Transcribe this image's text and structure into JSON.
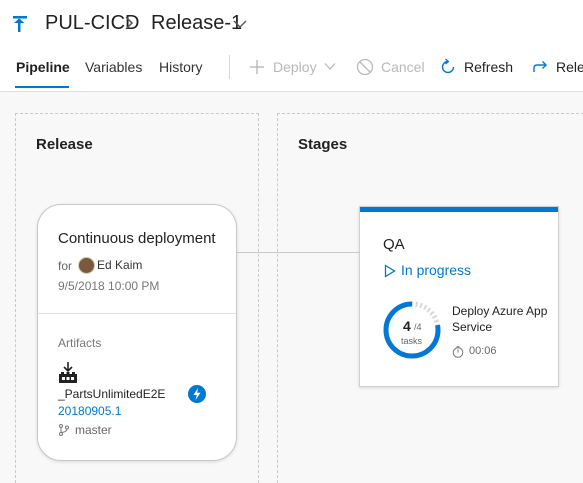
{
  "header": {
    "project": "PUL-CICD",
    "release": "Release-1"
  },
  "tabs": [
    {
      "label": "Pipeline",
      "active": true
    },
    {
      "label": "Variables",
      "active": false
    },
    {
      "label": "History",
      "active": false
    }
  ],
  "toolbar": {
    "deploy": "Deploy",
    "cancel": "Cancel",
    "refresh": "Refresh",
    "release": "Relea"
  },
  "release_panel": {
    "title": "Release",
    "trigger": "Continuous deployment",
    "for_label": "for",
    "user": "Ed Kaim",
    "date": "9/5/2018 10:00 PM",
    "artifacts_label": "Artifacts",
    "artifact_name": "_PartsUnlimitedE2E",
    "build": "20180905.1",
    "branch": "master"
  },
  "stages_panel": {
    "title": "Stages",
    "stage": {
      "name": "QA",
      "status": "In progress",
      "tasks_done": "4",
      "tasks_total": "/4",
      "tasks_label": "tasks",
      "progress_fraction": 1.0,
      "task_name": "Deploy Azure App Service",
      "duration": "00:06"
    }
  },
  "colors": {
    "accent": "#0078d4",
    "disabled": "#b8b8b8"
  }
}
